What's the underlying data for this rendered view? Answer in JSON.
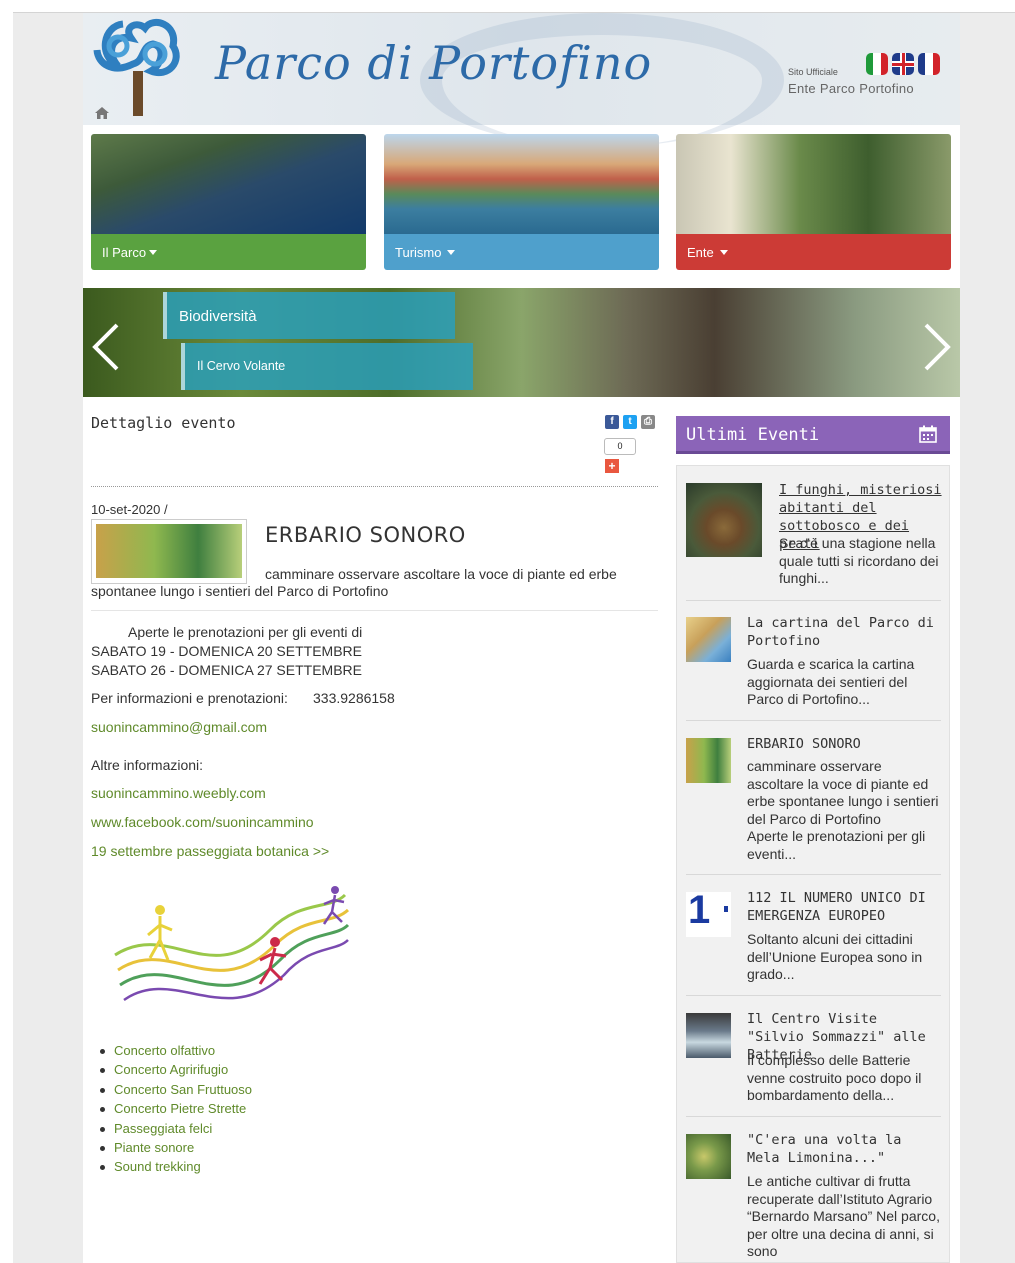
{
  "header": {
    "site_title": "Parco di Portofino",
    "sito_label": "Sito Ufficiale",
    "ente_label": "Ente Parco Portofino",
    "flags": [
      "it-flag-icon",
      "uk-flag-icon",
      "fr-flag-icon"
    ]
  },
  "nav": [
    {
      "label": "Il Parco",
      "color": "#5aa240"
    },
    {
      "label": "Turismo",
      "color": "#4fa0cc"
    },
    {
      "label": "Ente",
      "color": "#cc3b36"
    }
  ],
  "slider": {
    "caption_main": "Biodiversità",
    "caption_sub": "Il Cervo Volante"
  },
  "main": {
    "section_title": "Dettaglio evento",
    "share_count": "0",
    "date": "10-set-2020 /",
    "event_title": "ERBARIO SONORO",
    "event_desc_1": "camminare osservare ascoltare la voce di piante ed erbe",
    "event_desc_2": "spontanee lungo i sentieri del Parco di Portofino",
    "body_1": "Aperte le prenotazioni per gli eventi di",
    "body_2": "SABATO 19 - DOMENICA 20 SETTEMBRE",
    "body_3": "SABATO 26 - DOMENICA 27 SETTEMBRE",
    "info_label": "Per informazioni e prenotazioni:",
    "info_phone": "333.9286158",
    "email_link": "suonincammino@gmail.com",
    "altre_label": "Altre informazioni:",
    "link_weebly": "suonincammino.weebly.com",
    "link_facebook": "www.facebook.com/suonincammino",
    "link_passeggiata": "19 settembre passeggiata botanica >>",
    "bullets": [
      "Concerto olfattivo",
      "Concerto Agririfugio",
      "Concerto San Fruttuoso",
      "Concerto Pietre Strette",
      "Passeggiata felci",
      "Piante sonore",
      "Sound trekking"
    ]
  },
  "sidebar": {
    "title": "Ultimi Eventi",
    "items": [
      {
        "title": "I funghi, misteriosi abitanti del sottobosco e dei prati",
        "text": "Se c’è una stagione nella quale tutti si ricordano dei funghi..."
      },
      {
        "title": "La cartina del Parco di Portofino",
        "text": "Guarda e scarica la cartina aggiornata dei sentieri del Parco di Portofino..."
      },
      {
        "title": "ERBARIO SONORO",
        "text": "camminare osservare ascoltare la voce di piante ed erbe spontanee lungo i sentieri del Parco di Portofino\n        Aperte le prenotazioni per gli eventi..."
      },
      {
        "title": "112 IL NUMERO UNICO DI EMERGENZA EUROPEO",
        "text": "Soltanto alcuni dei cittadini dell’Unione Europea sono in grado..."
      },
      {
        "title": "Il Centro Visite \"Silvio Sommazzi\" alle Batterie",
        "text": "Il complesso delle Batterie venne costruito poco dopo il bombardamento della..."
      },
      {
        "title": "\"C'era una volta la Mela Limonina...\"",
        "text": "Le antiche cultivar di frutta recuperate dall’Istituto Agrario “Bernardo Marsano” Nel parco, per oltre una decina di anni, si sono"
      }
    ]
  }
}
